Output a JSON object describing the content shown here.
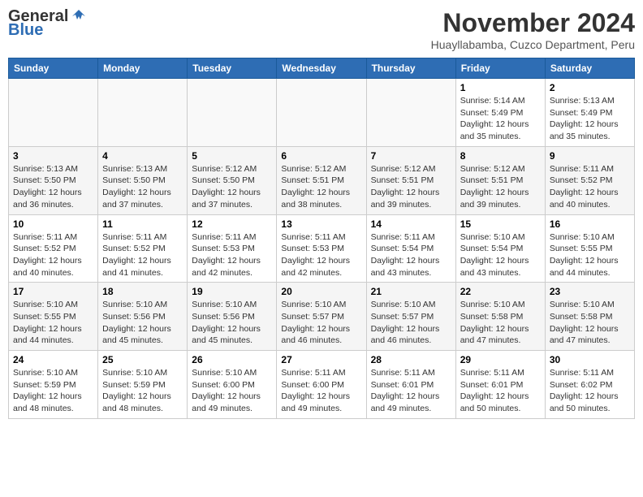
{
  "header": {
    "logo_line1": "General",
    "logo_line2": "Blue",
    "month_title": "November 2024",
    "subtitle": "Huayllabamba, Cuzco Department, Peru"
  },
  "days_of_week": [
    "Sunday",
    "Monday",
    "Tuesday",
    "Wednesday",
    "Thursday",
    "Friday",
    "Saturday"
  ],
  "weeks": [
    [
      {
        "day": "",
        "info": ""
      },
      {
        "day": "",
        "info": ""
      },
      {
        "day": "",
        "info": ""
      },
      {
        "day": "",
        "info": ""
      },
      {
        "day": "",
        "info": ""
      },
      {
        "day": "1",
        "info": "Sunrise: 5:14 AM\nSunset: 5:49 PM\nDaylight: 12 hours\nand 35 minutes."
      },
      {
        "day": "2",
        "info": "Sunrise: 5:13 AM\nSunset: 5:49 PM\nDaylight: 12 hours\nand 35 minutes."
      }
    ],
    [
      {
        "day": "3",
        "info": "Sunrise: 5:13 AM\nSunset: 5:50 PM\nDaylight: 12 hours\nand 36 minutes."
      },
      {
        "day": "4",
        "info": "Sunrise: 5:13 AM\nSunset: 5:50 PM\nDaylight: 12 hours\nand 37 minutes."
      },
      {
        "day": "5",
        "info": "Sunrise: 5:12 AM\nSunset: 5:50 PM\nDaylight: 12 hours\nand 37 minutes."
      },
      {
        "day": "6",
        "info": "Sunrise: 5:12 AM\nSunset: 5:51 PM\nDaylight: 12 hours\nand 38 minutes."
      },
      {
        "day": "7",
        "info": "Sunrise: 5:12 AM\nSunset: 5:51 PM\nDaylight: 12 hours\nand 39 minutes."
      },
      {
        "day": "8",
        "info": "Sunrise: 5:12 AM\nSunset: 5:51 PM\nDaylight: 12 hours\nand 39 minutes."
      },
      {
        "day": "9",
        "info": "Sunrise: 5:11 AM\nSunset: 5:52 PM\nDaylight: 12 hours\nand 40 minutes."
      }
    ],
    [
      {
        "day": "10",
        "info": "Sunrise: 5:11 AM\nSunset: 5:52 PM\nDaylight: 12 hours\nand 40 minutes."
      },
      {
        "day": "11",
        "info": "Sunrise: 5:11 AM\nSunset: 5:52 PM\nDaylight: 12 hours\nand 41 minutes."
      },
      {
        "day": "12",
        "info": "Sunrise: 5:11 AM\nSunset: 5:53 PM\nDaylight: 12 hours\nand 42 minutes."
      },
      {
        "day": "13",
        "info": "Sunrise: 5:11 AM\nSunset: 5:53 PM\nDaylight: 12 hours\nand 42 minutes."
      },
      {
        "day": "14",
        "info": "Sunrise: 5:11 AM\nSunset: 5:54 PM\nDaylight: 12 hours\nand 43 minutes."
      },
      {
        "day": "15",
        "info": "Sunrise: 5:10 AM\nSunset: 5:54 PM\nDaylight: 12 hours\nand 43 minutes."
      },
      {
        "day": "16",
        "info": "Sunrise: 5:10 AM\nSunset: 5:55 PM\nDaylight: 12 hours\nand 44 minutes."
      }
    ],
    [
      {
        "day": "17",
        "info": "Sunrise: 5:10 AM\nSunset: 5:55 PM\nDaylight: 12 hours\nand 44 minutes."
      },
      {
        "day": "18",
        "info": "Sunrise: 5:10 AM\nSunset: 5:56 PM\nDaylight: 12 hours\nand 45 minutes."
      },
      {
        "day": "19",
        "info": "Sunrise: 5:10 AM\nSunset: 5:56 PM\nDaylight: 12 hours\nand 45 minutes."
      },
      {
        "day": "20",
        "info": "Sunrise: 5:10 AM\nSunset: 5:57 PM\nDaylight: 12 hours\nand 46 minutes."
      },
      {
        "day": "21",
        "info": "Sunrise: 5:10 AM\nSunset: 5:57 PM\nDaylight: 12 hours\nand 46 minutes."
      },
      {
        "day": "22",
        "info": "Sunrise: 5:10 AM\nSunset: 5:58 PM\nDaylight: 12 hours\nand 47 minutes."
      },
      {
        "day": "23",
        "info": "Sunrise: 5:10 AM\nSunset: 5:58 PM\nDaylight: 12 hours\nand 47 minutes."
      }
    ],
    [
      {
        "day": "24",
        "info": "Sunrise: 5:10 AM\nSunset: 5:59 PM\nDaylight: 12 hours\nand 48 minutes."
      },
      {
        "day": "25",
        "info": "Sunrise: 5:10 AM\nSunset: 5:59 PM\nDaylight: 12 hours\nand 48 minutes."
      },
      {
        "day": "26",
        "info": "Sunrise: 5:10 AM\nSunset: 6:00 PM\nDaylight: 12 hours\nand 49 minutes."
      },
      {
        "day": "27",
        "info": "Sunrise: 5:11 AM\nSunset: 6:00 PM\nDaylight: 12 hours\nand 49 minutes."
      },
      {
        "day": "28",
        "info": "Sunrise: 5:11 AM\nSunset: 6:01 PM\nDaylight: 12 hours\nand 49 minutes."
      },
      {
        "day": "29",
        "info": "Sunrise: 5:11 AM\nSunset: 6:01 PM\nDaylight: 12 hours\nand 50 minutes."
      },
      {
        "day": "30",
        "info": "Sunrise: 5:11 AM\nSunset: 6:02 PM\nDaylight: 12 hours\nand 50 minutes."
      }
    ]
  ]
}
